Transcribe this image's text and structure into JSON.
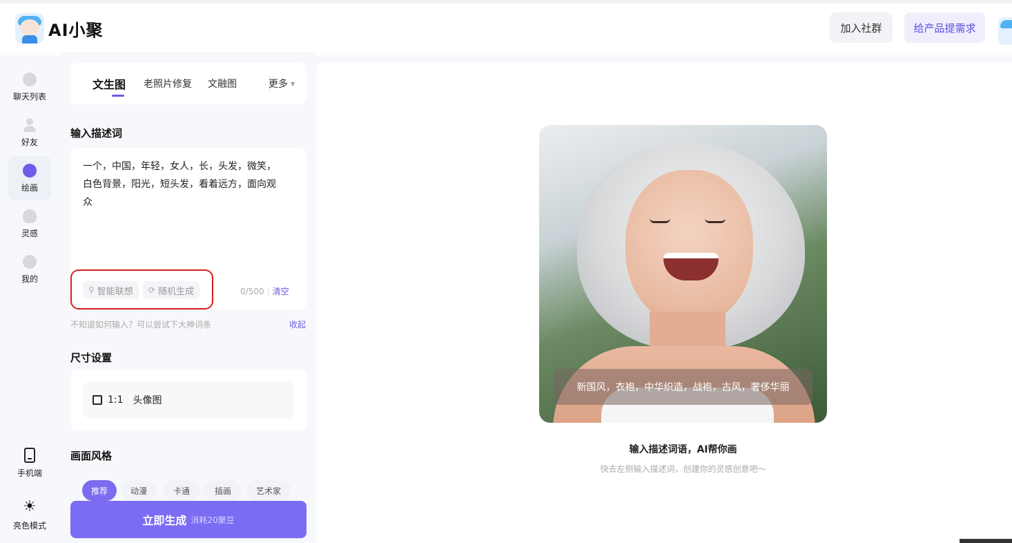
{
  "app": {
    "logo_text": "AI小聚",
    "header_buttons": {
      "join": "加入社群",
      "feedback": "给产品提需求"
    }
  },
  "nav": {
    "items": [
      {
        "label": "聊天列表",
        "icon": "chat-bubble-icon"
      },
      {
        "label": "好友",
        "icon": "person-icon"
      },
      {
        "label": "绘画",
        "icon": "palette-icon",
        "active": true
      },
      {
        "label": "灵感",
        "icon": "lightbulb-icon"
      },
      {
        "label": "我的",
        "icon": "smile-icon"
      }
    ],
    "bottom": [
      {
        "label": "手机端",
        "icon": "phone-icon"
      },
      {
        "label": "亮色模式",
        "icon": "sun-icon"
      }
    ]
  },
  "panel": {
    "tabs": [
      "文生图",
      "老照片修复",
      "文融图",
      "更多"
    ],
    "prompt_title": "输入描述词",
    "prompt_text": "一个，中国，年轻，女人，长，头发，微笑，\n白色背景，阳光，短头发，看着远方，面向观\n众",
    "chips": {
      "smart": "智能联想",
      "random": "随机生成"
    },
    "counter": "0/500",
    "clear": "清空",
    "hint": "不知道如何输入？可以尝试下大神词条",
    "collapse": "收起",
    "size_title": "尺寸设置",
    "size_option": {
      "ratio": "1:1",
      "label": "头像图"
    },
    "style_title": "画面风格",
    "style_chips": [
      "推荐",
      "动漫",
      "卡通",
      "插画",
      "艺术家"
    ],
    "generate_button": {
      "label": "立即生成",
      "cost": "消耗20聚豆"
    }
  },
  "main": {
    "photo_caption": "新国风，衣袍，中华织造，战袍，古风，奢侈华丽",
    "title": "输入描述词语，AI帮你画",
    "subtitle": "快去左侧输入描述词，创建你的灵感创意吧～"
  },
  "colors": {
    "accent": "#6c5ce7",
    "highlight_border": "#d61f1f"
  }
}
